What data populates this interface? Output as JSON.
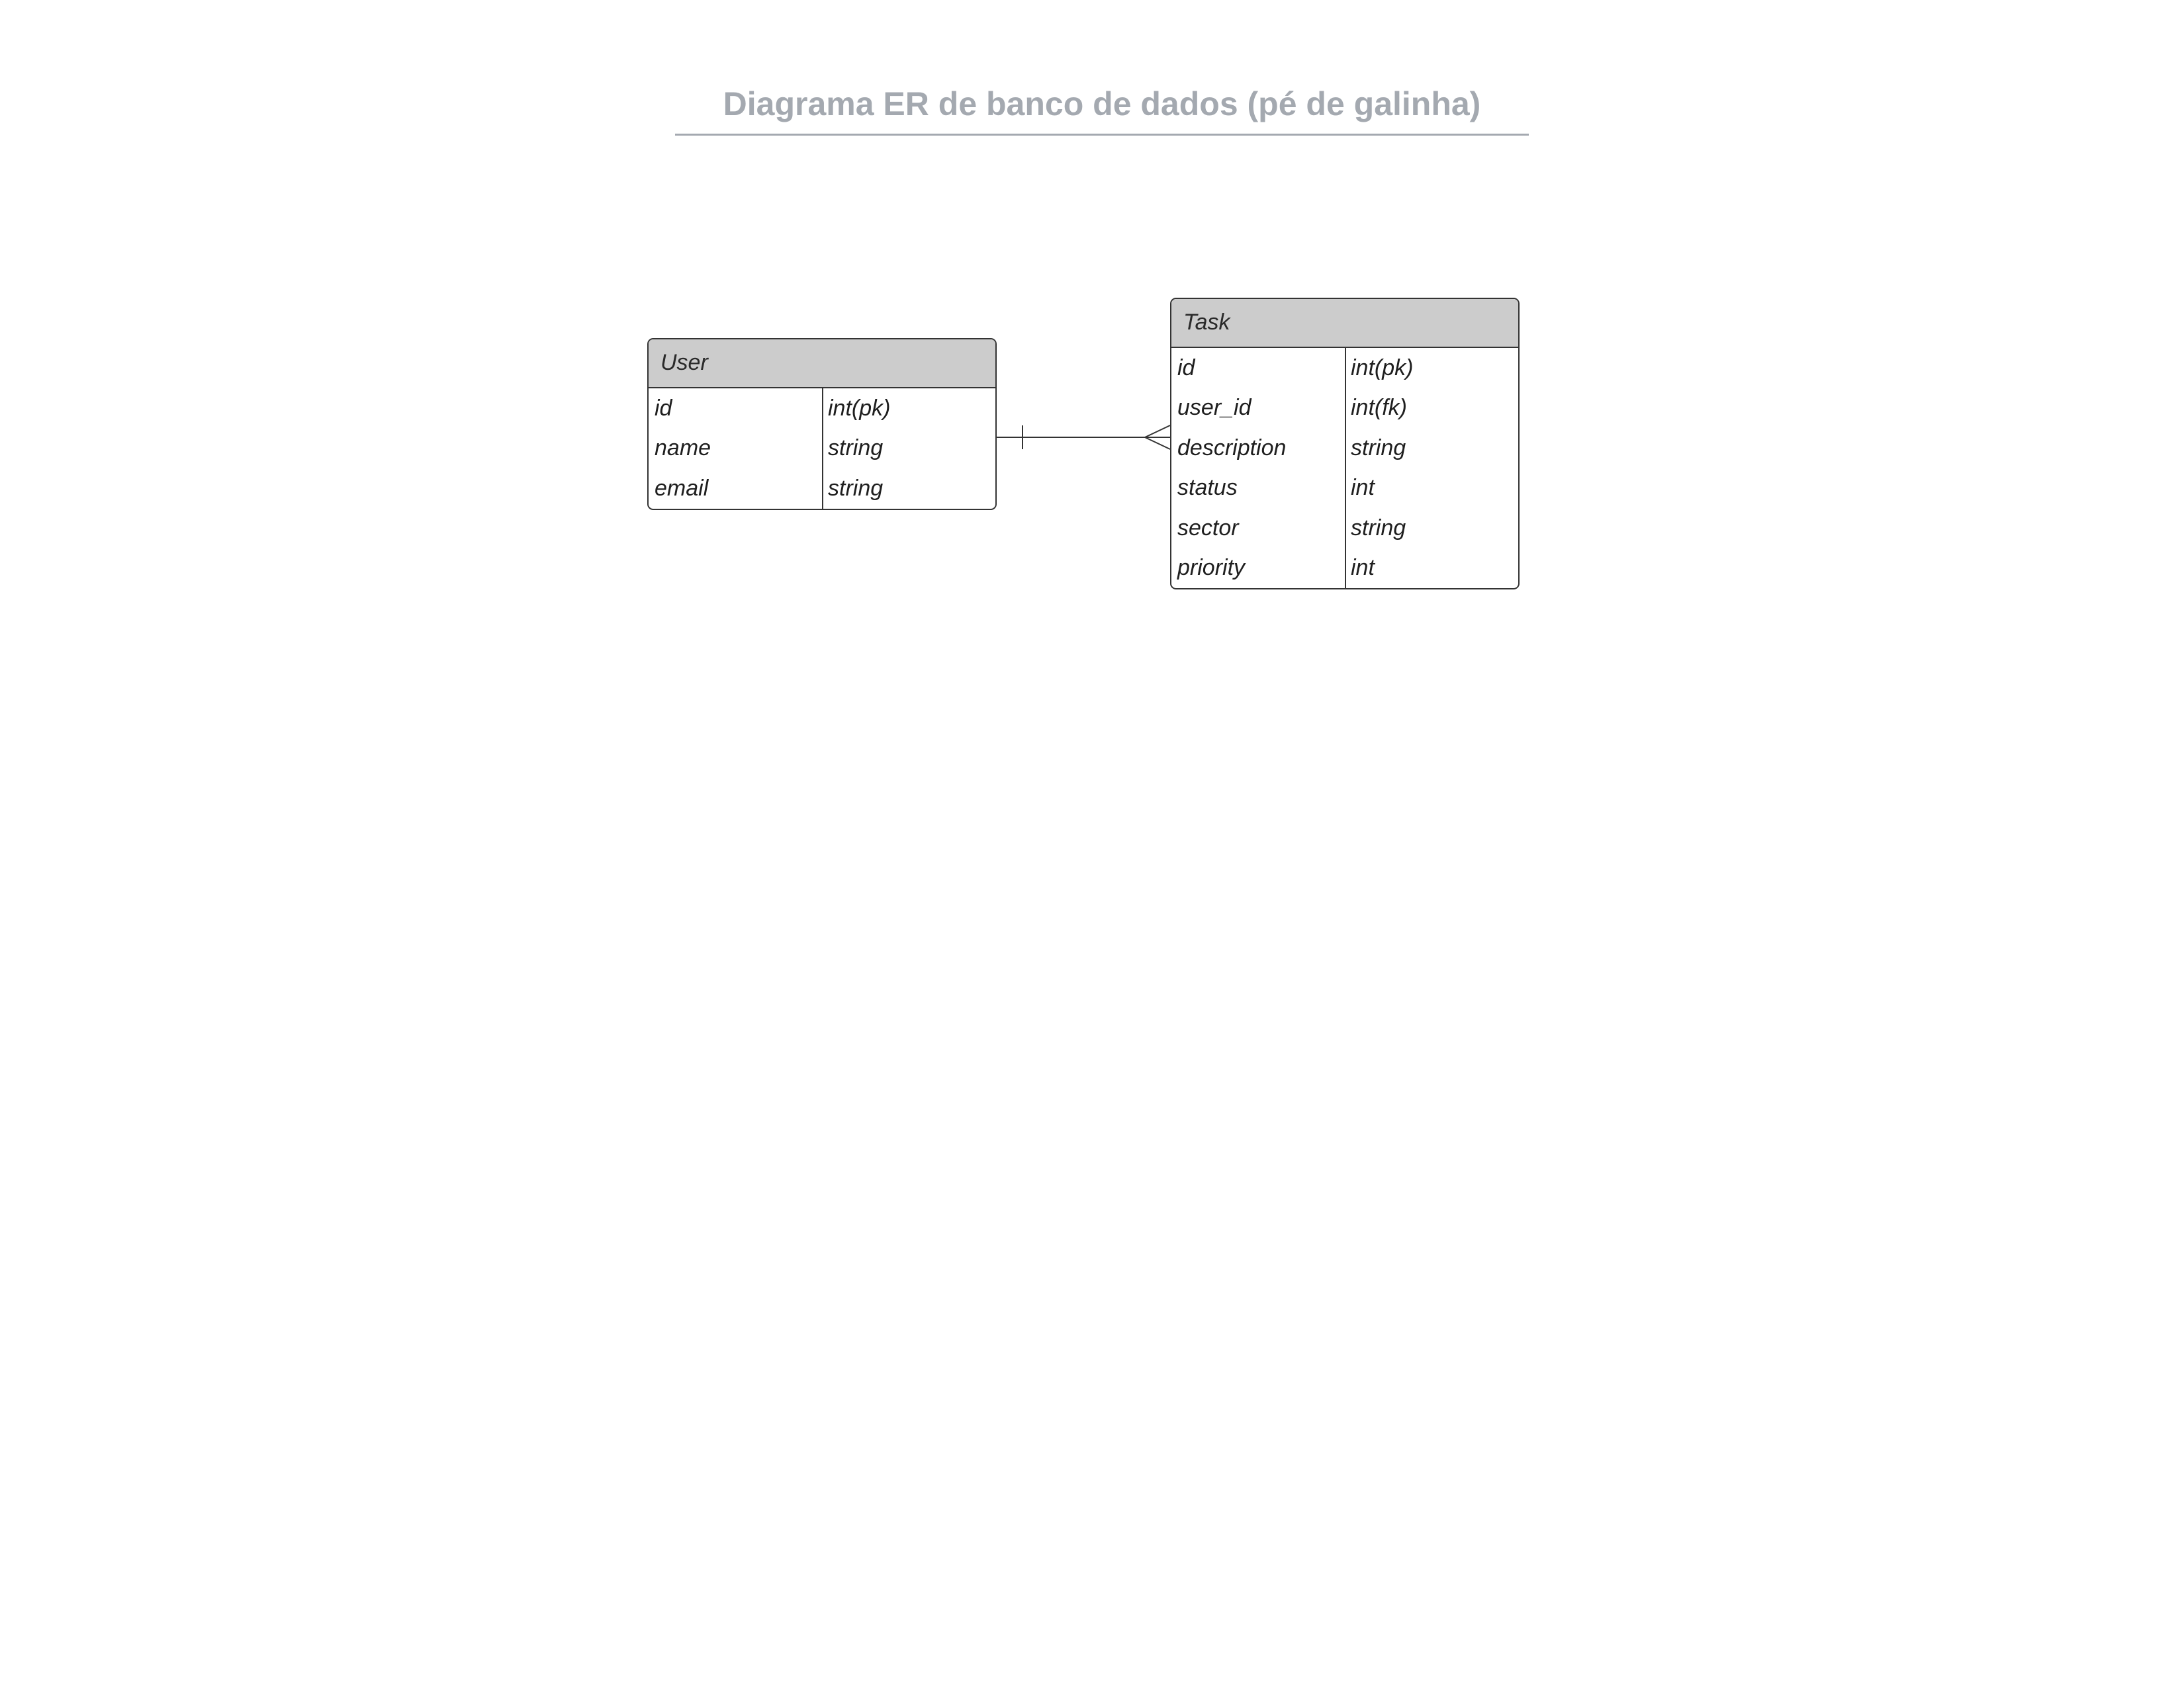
{
  "title": "Diagrama ER de banco de dados (pé de galinha)",
  "entities": {
    "user": {
      "name": "User",
      "attributes": [
        {
          "name": "id",
          "type": "int(pk)"
        },
        {
          "name": "name",
          "type": "string"
        },
        {
          "name": "email",
          "type": "string"
        }
      ]
    },
    "task": {
      "name": "Task",
      "attributes": [
        {
          "name": "id",
          "type": "int(pk)"
        },
        {
          "name": "user_id",
          "type": "int(fk)"
        },
        {
          "name": "description",
          "type": "string"
        },
        {
          "name": "status",
          "type": "int"
        },
        {
          "name": "sector",
          "type": "string"
        },
        {
          "name": "priority",
          "type": "int"
        }
      ]
    }
  },
  "relationships": [
    {
      "from": "User",
      "to": "Task",
      "from_cardinality": "one",
      "to_cardinality": "many"
    }
  ],
  "colors": {
    "title": "#a4a9b0",
    "header_fill": "#cccccc",
    "border": "#333333"
  }
}
